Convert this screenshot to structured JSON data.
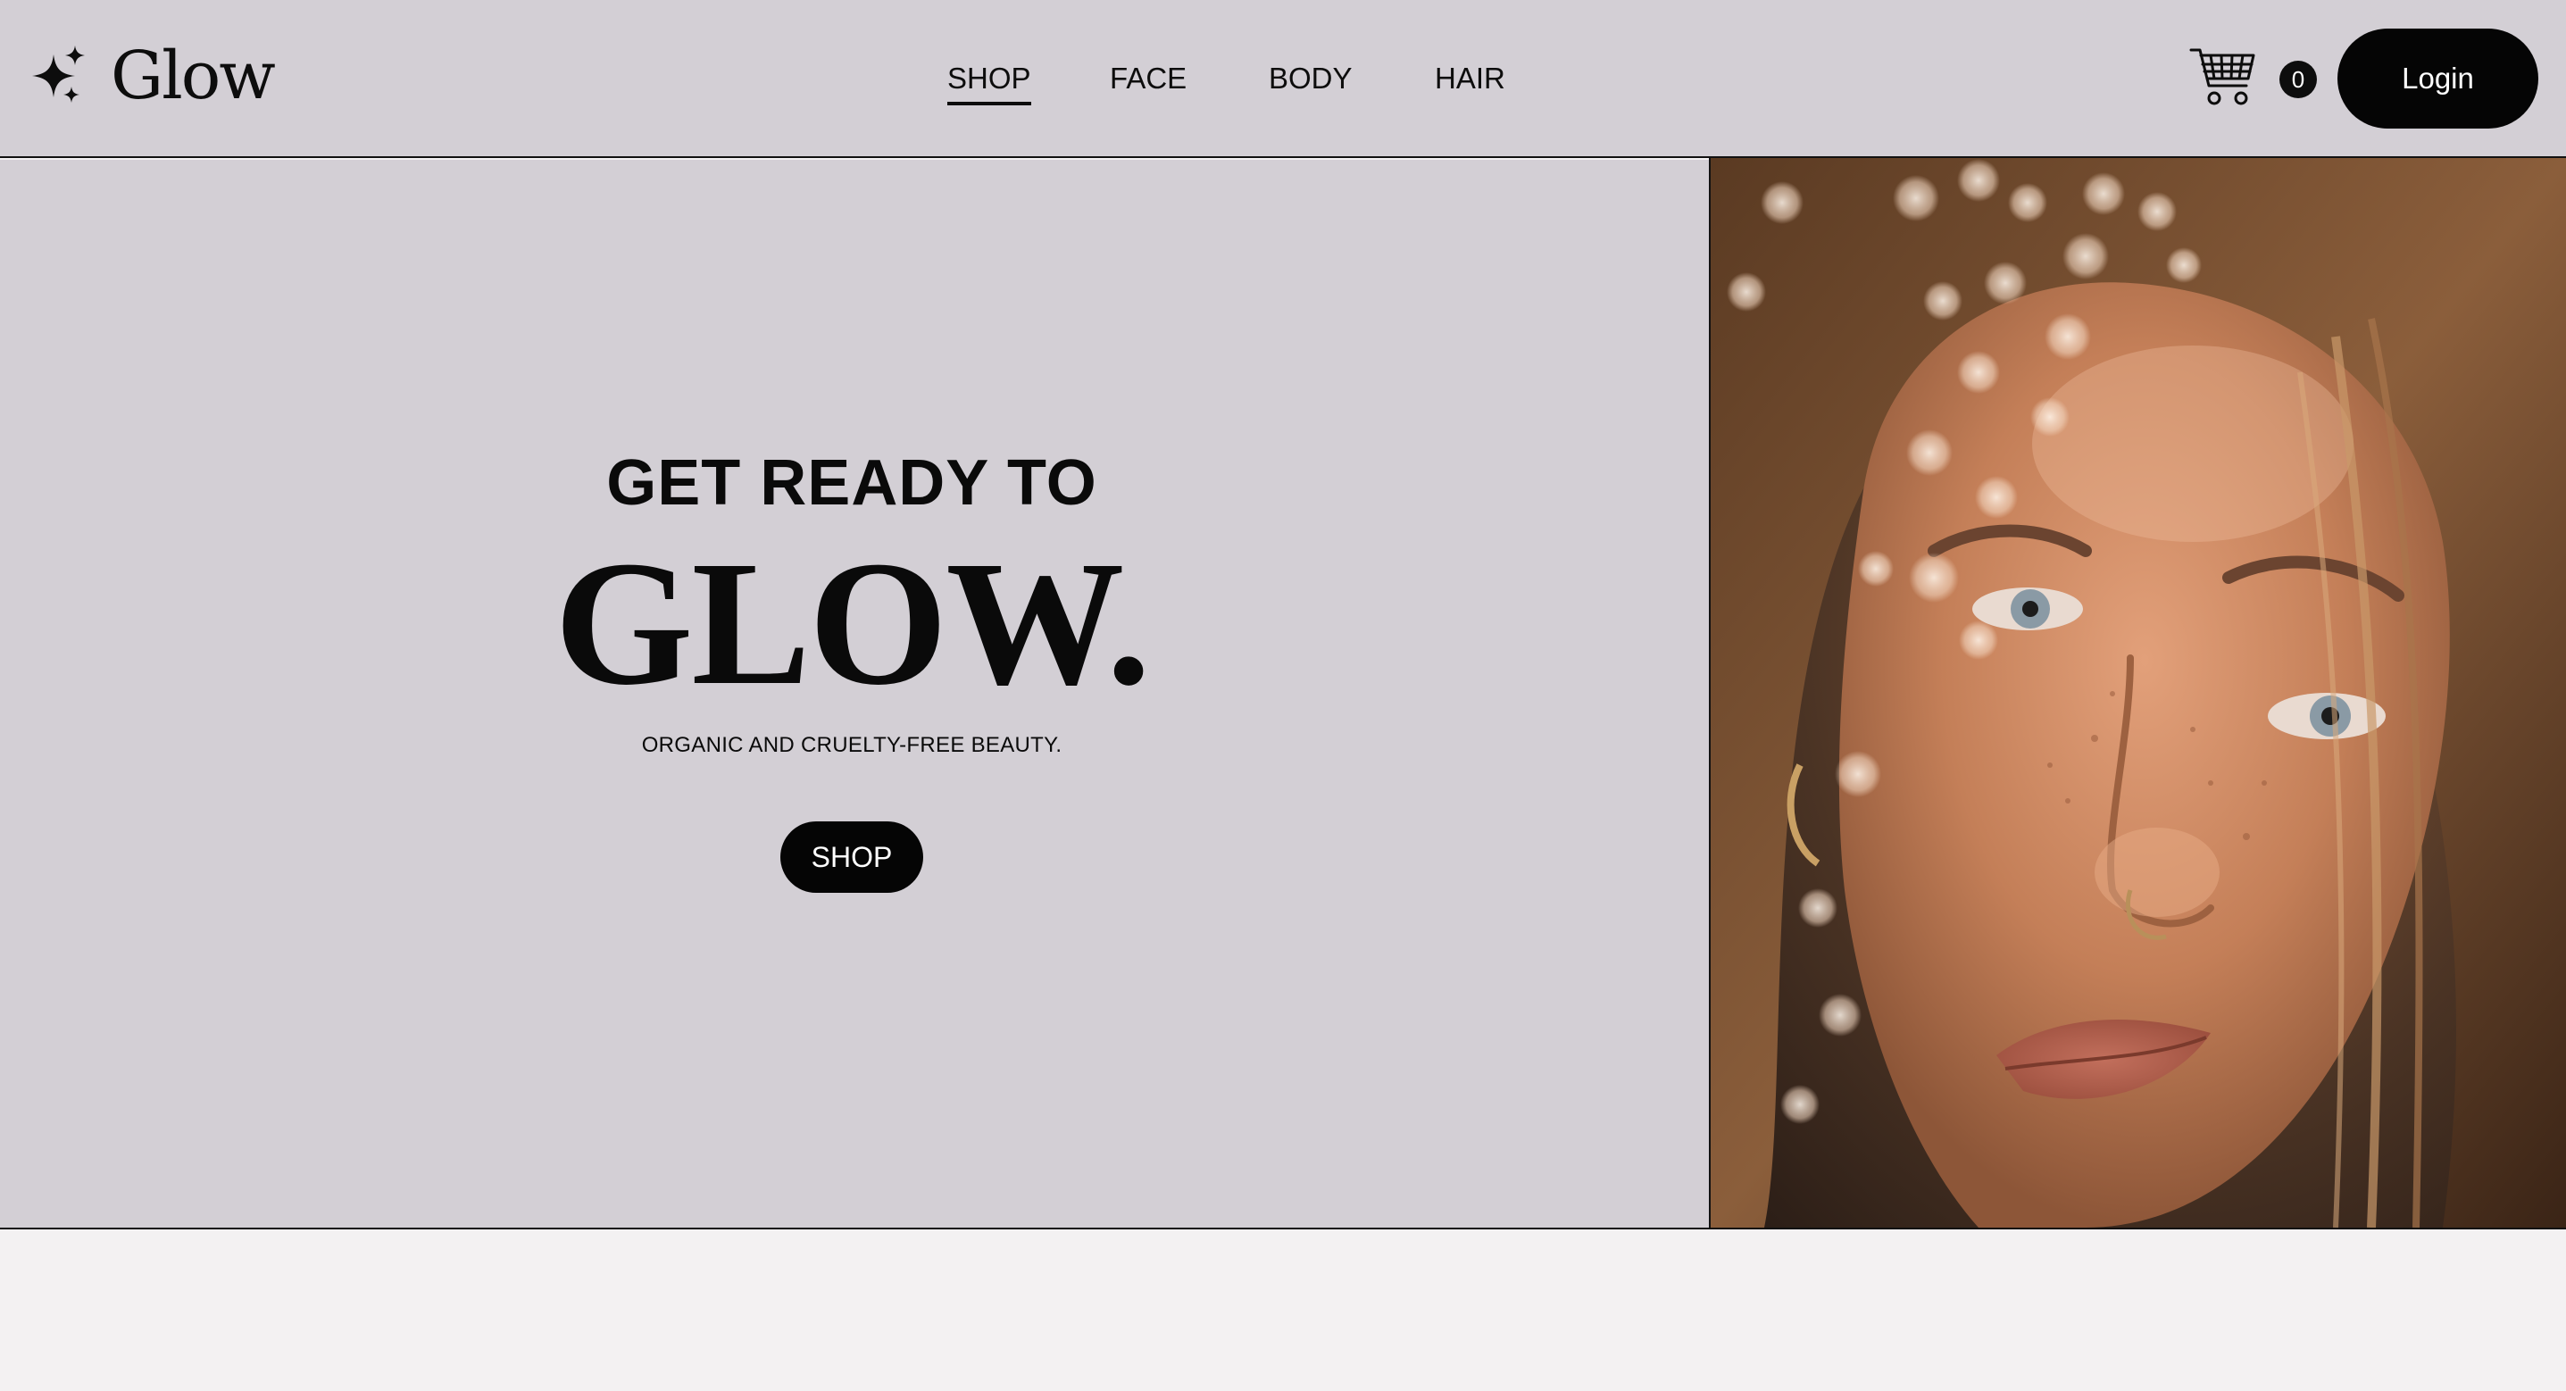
{
  "brand": {
    "name": "Glow",
    "logo_icon": "sparkle-icon"
  },
  "nav": {
    "items": [
      {
        "label": "SHOP",
        "active": true
      },
      {
        "label": "FACE",
        "active": false
      },
      {
        "label": "BODY",
        "active": false
      },
      {
        "label": "HAIR",
        "active": false
      }
    ]
  },
  "cart": {
    "icon": "shopping-cart-icon",
    "count": "0"
  },
  "login": {
    "label": "Login"
  },
  "hero": {
    "pre_title": "GET READY TO",
    "title": "GLOW.",
    "subtitle": "ORGANIC AND CRUELTY-FREE BEAUTY.",
    "cta_label": "SHOP",
    "image_alt": "Close-up portrait of a woman with freckles and light bokeh"
  },
  "colors": {
    "header_bg": "#d3cfd5",
    "hero_bg": "#d3cfd5",
    "page_bg": "#f3f1f2",
    "button_bg": "#050505",
    "button_text": "#ffffff",
    "text": "#0d0d0d"
  }
}
